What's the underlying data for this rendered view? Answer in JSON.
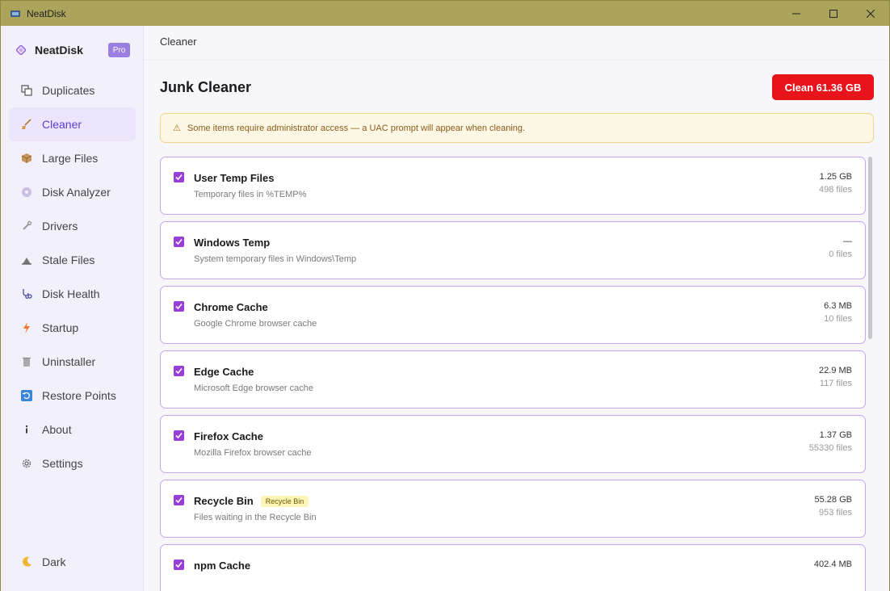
{
  "window": {
    "title": "NeatDisk"
  },
  "sidebar": {
    "brand": "NeatDisk",
    "badge": "Pro",
    "items": [
      {
        "label": "Duplicates",
        "icon": "duplicates-icon"
      },
      {
        "label": "Cleaner",
        "icon": "broom-icon",
        "active": true
      },
      {
        "label": "Large Files",
        "icon": "package-icon"
      },
      {
        "label": "Disk Analyzer",
        "icon": "disk-icon"
      },
      {
        "label": "Drivers",
        "icon": "wrench-icon"
      },
      {
        "label": "Stale Files",
        "icon": "hourglass-icon"
      },
      {
        "label": "Disk Health",
        "icon": "stethoscope-icon"
      },
      {
        "label": "Startup",
        "icon": "lightning-icon"
      },
      {
        "label": "Uninstaller",
        "icon": "trash-icon"
      },
      {
        "label": "Restore Points",
        "icon": "restore-icon"
      },
      {
        "label": "About",
        "icon": "info-icon"
      },
      {
        "label": "Settings",
        "icon": "gear-icon"
      }
    ],
    "theme_toggle": "Dark"
  },
  "main": {
    "breadcrumb": "Cleaner",
    "title": "Junk Cleaner",
    "clean_button": "Clean 61.36 GB",
    "alert": "Some items require administrator access — a UAC prompt will appear when cleaning.",
    "items": [
      {
        "name": "User Temp Files",
        "desc": "Temporary files in %TEMP%",
        "size": "1.25 GB",
        "count": "498 files",
        "checked": true
      },
      {
        "name": "Windows Temp",
        "desc": "System temporary files in Windows\\Temp",
        "size": "—",
        "count": "0 files",
        "checked": true
      },
      {
        "name": "Chrome Cache",
        "desc": "Google Chrome browser cache",
        "size": "6.3 MB",
        "count": "10 files",
        "checked": true
      },
      {
        "name": "Edge Cache",
        "desc": "Microsoft Edge browser cache",
        "size": "22.9 MB",
        "count": "117 files",
        "checked": true
      },
      {
        "name": "Firefox Cache",
        "desc": "Mozilla Firefox browser cache",
        "size": "1.37 GB",
        "count": "55330 files",
        "checked": true
      },
      {
        "name": "Recycle Bin",
        "tag": "Recycle Bin",
        "desc": "Files waiting in the Recycle Bin",
        "size": "55.28 GB",
        "count": "953 files",
        "checked": true
      },
      {
        "name": "npm Cache",
        "desc": "",
        "size": "402.4 MB",
        "count": "",
        "checked": true
      }
    ]
  },
  "colors": {
    "accent": "#9a3ed8",
    "danger": "#e8131b",
    "titlebar": "#aba45a"
  }
}
